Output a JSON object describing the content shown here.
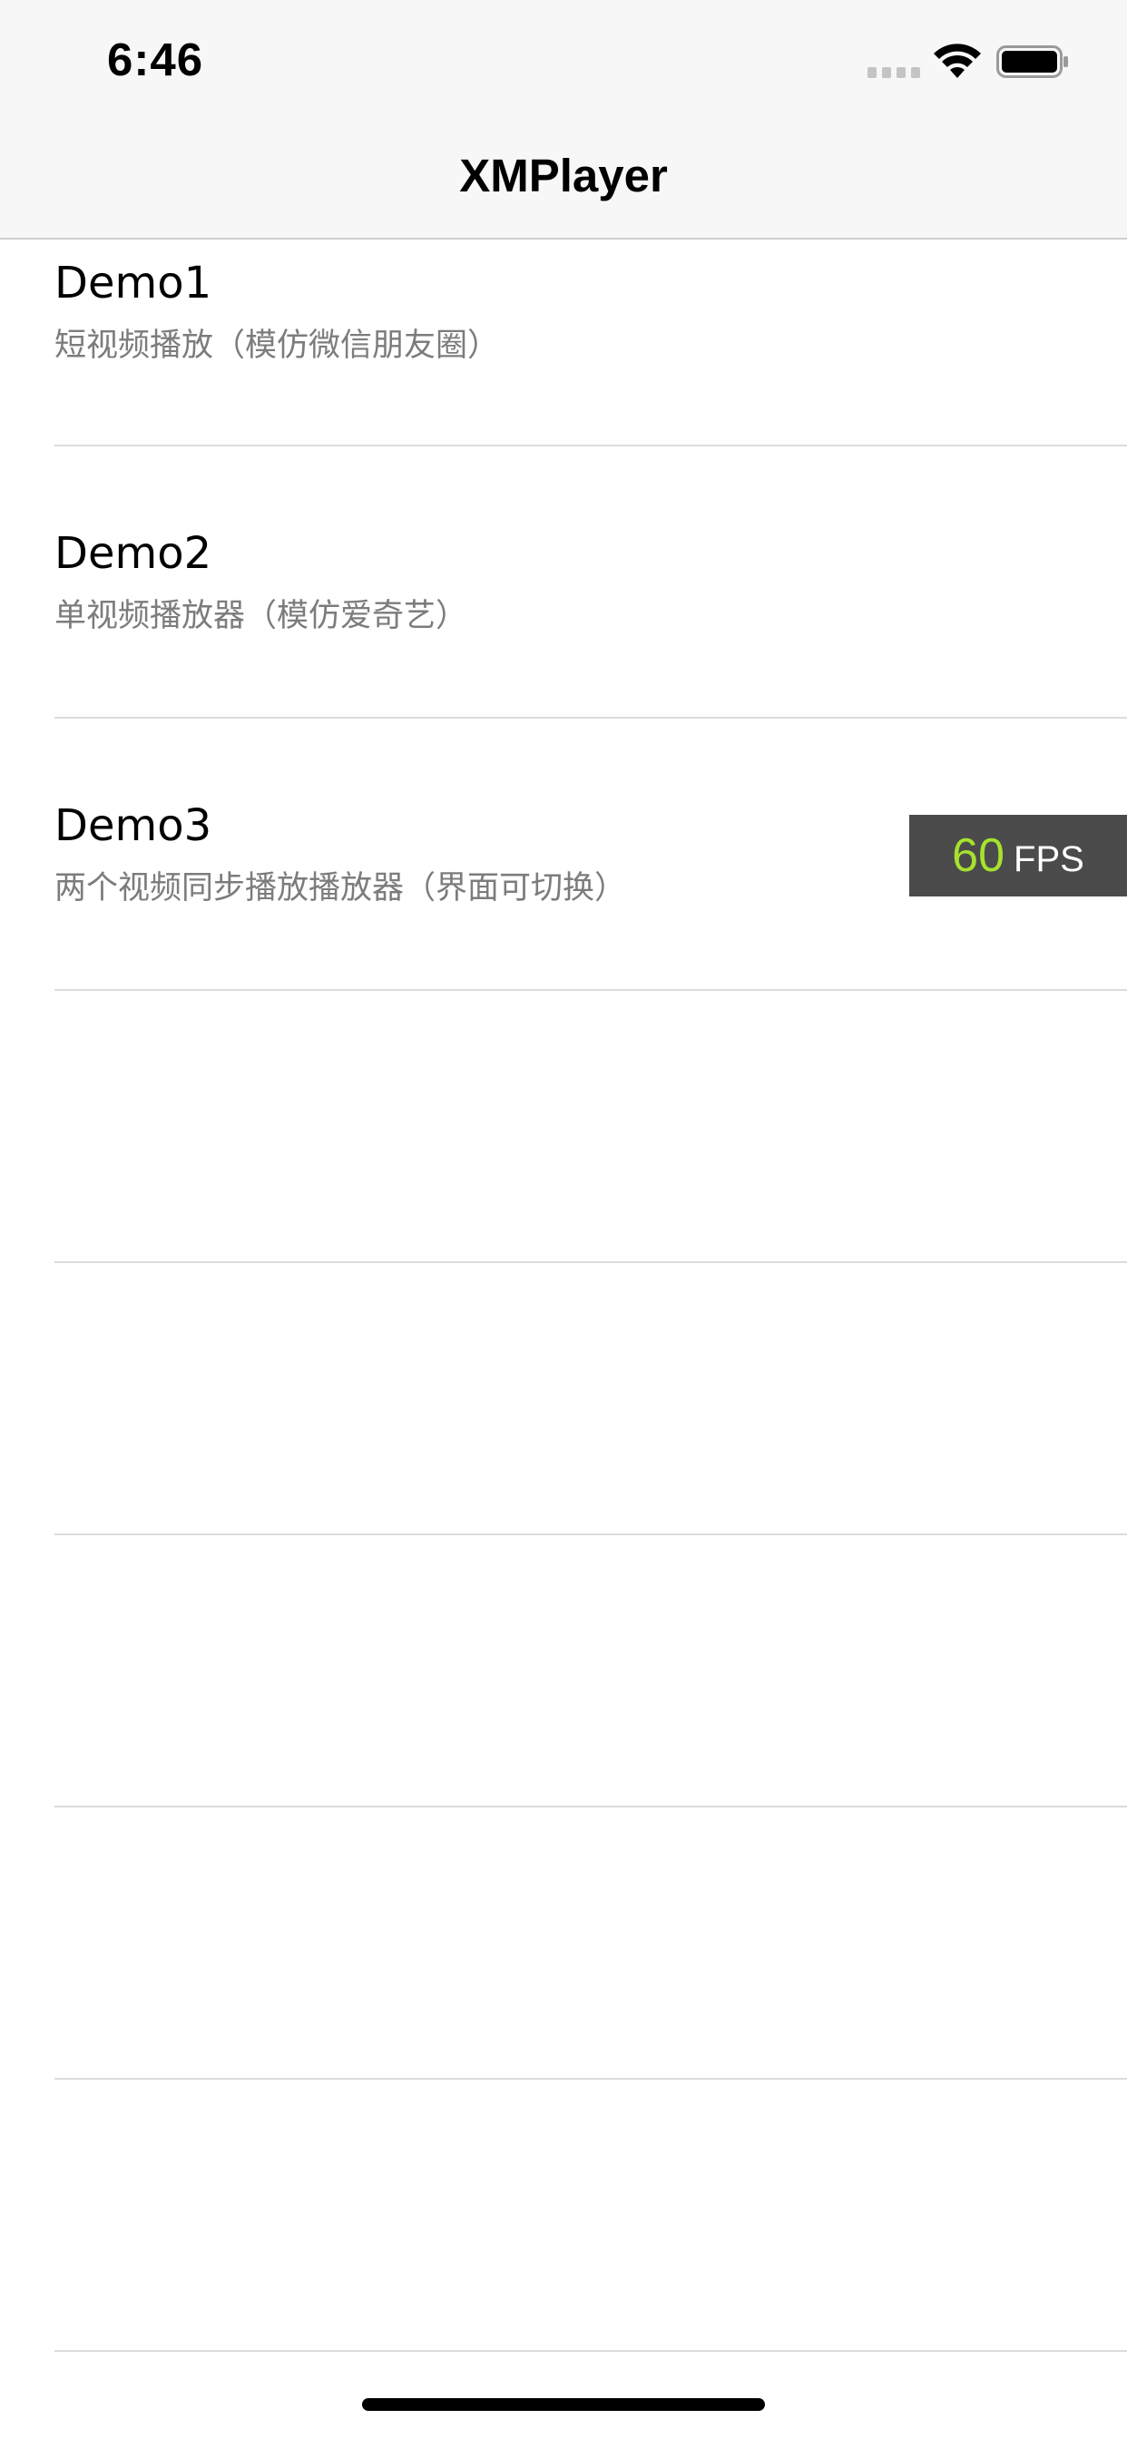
{
  "status_bar": {
    "time": "6:46",
    "signal_icon": "cellular-signal-icon",
    "wifi_icon": "wifi-icon",
    "battery_icon": "battery-full-icon"
  },
  "nav": {
    "title": "XMPlayer"
  },
  "rows": [
    {
      "title": "Demo1",
      "subtitle": "短视频播放（模仿微信朋友圈）"
    },
    {
      "title": "Demo2",
      "subtitle": "单视频播放器（模仿爱奇艺）"
    },
    {
      "title": "Demo3",
      "subtitle": "两个视频同步播放播放器（界面可切换）"
    }
  ],
  "fps": {
    "value": "60",
    "unit": "FPS",
    "value_color": "#a6e22e"
  },
  "colors": {
    "nav_background": "#f7f7f7",
    "subtitle_text": "#7c7c7c",
    "separator": "#dcdcde"
  }
}
